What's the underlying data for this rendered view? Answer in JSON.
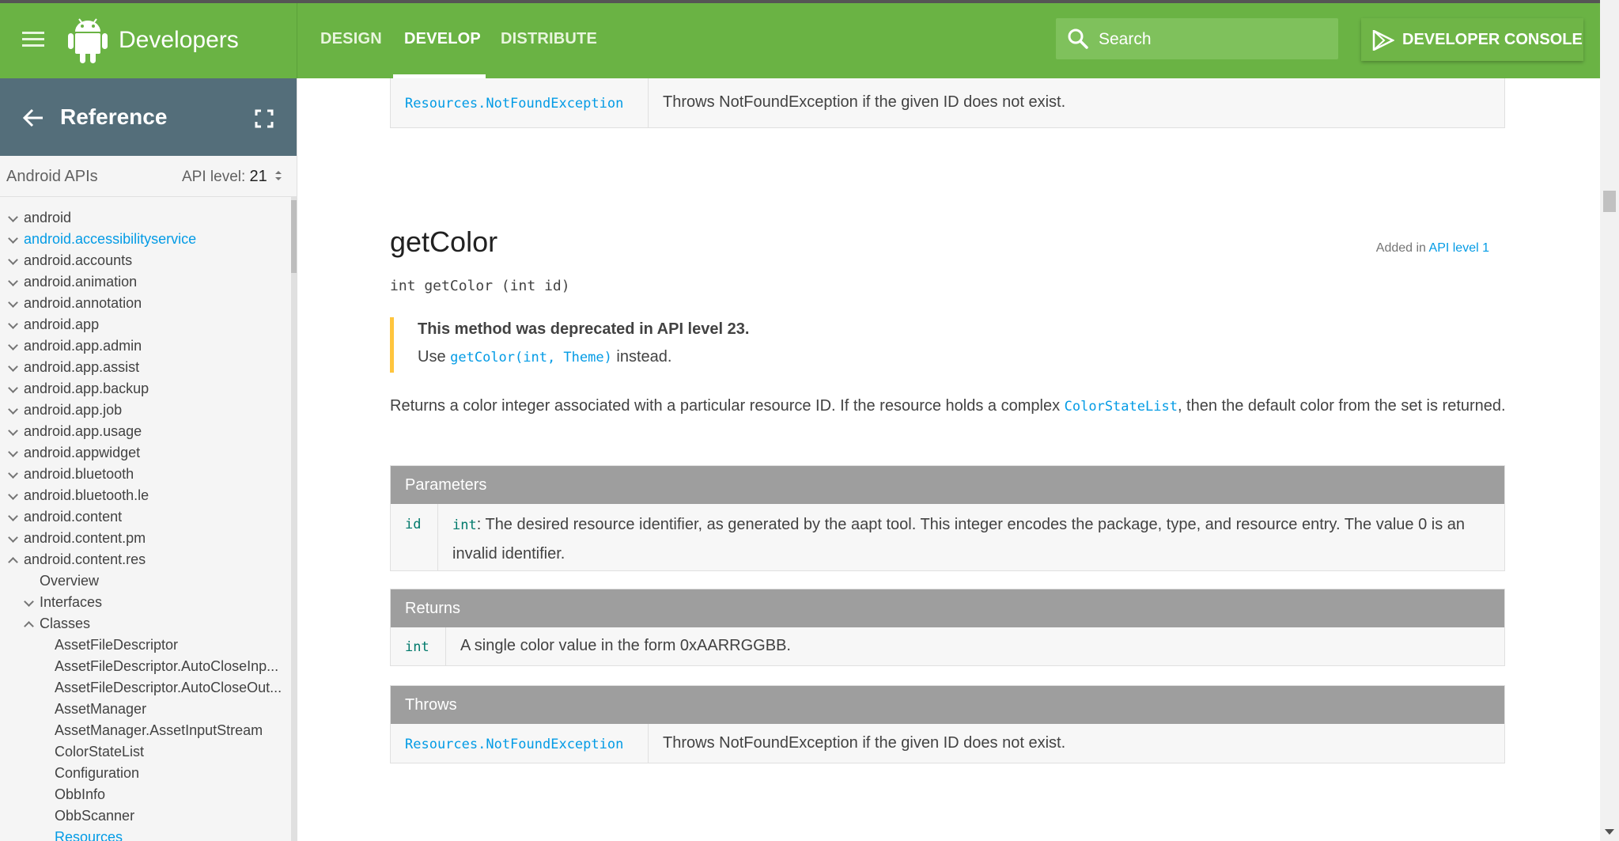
{
  "header": {
    "brand": "Developers",
    "tabs": [
      "DESIGN",
      "DEVELOP",
      "DISTRIBUTE"
    ],
    "active_tab": "DEVELOP",
    "search_placeholder": "Search",
    "console_label": "DEVELOPER CONSOLE"
  },
  "sidebar": {
    "title": "Reference",
    "api_label": "Android APIs",
    "api_level_prefix": "API level:",
    "api_level_value": "21",
    "packages": [
      "android",
      "android.accessibilityservice",
      "android.accounts",
      "android.animation",
      "android.annotation",
      "android.app",
      "android.app.admin",
      "android.app.assist",
      "android.app.backup",
      "android.app.job",
      "android.app.usage",
      "android.appwidget",
      "android.bluetooth",
      "android.bluetooth.le",
      "android.content",
      "android.content.pm",
      "android.content.res"
    ],
    "subsections": [
      "Overview",
      "Interfaces",
      "Classes"
    ],
    "classes": [
      "AssetFileDescriptor",
      "AssetFileDescriptor.AutoCloseInp...",
      "AssetFileDescriptor.AutoCloseOut...",
      "AssetManager",
      "AssetManager.AssetInputStream",
      "ColorStateList",
      "Configuration",
      "ObbInfo",
      "ObbScanner",
      "Resources"
    ]
  },
  "content": {
    "top_throws": {
      "exception": "Resources.NotFoundException",
      "description": "Throws NotFoundException if the given ID does not exist."
    },
    "method_name": "getColor",
    "added_prefix": "Added in",
    "added_link": "API level 1",
    "signature": "int getColor (int id)",
    "deprecated_title": "This method was deprecated in API level 23.",
    "deprecated_use": "Use",
    "deprecated_link": "getColor(int, Theme)",
    "deprecated_suffix": "instead.",
    "desc_part1": "Returns a color integer associated with a particular resource ID. If the resource holds a complex",
    "desc_link": "ColorStateList",
    "desc_part2": ", then the default color from the set is returned.",
    "parameters": {
      "header": "Parameters",
      "name": "id",
      "type": "int",
      "description": ": The desired resource identifier, as generated by the aapt tool. This integer encodes the package, type, and resource entry. The value 0 is an invalid identifier."
    },
    "returns": {
      "header": "Returns",
      "type": "int",
      "description": "A single color value in the form 0xAARRGGBB."
    },
    "throws": {
      "header": "Throws",
      "exception": "Resources.NotFoundException",
      "description": "Throws NotFoundException if the given ID does not exist."
    }
  },
  "colors": {
    "header_green": "#6ab344",
    "sidebar_header": "#546e7a",
    "link_blue": "#039be5",
    "table_header": "#9e9e9e",
    "deprecated_bar": "#ffc53d"
  }
}
